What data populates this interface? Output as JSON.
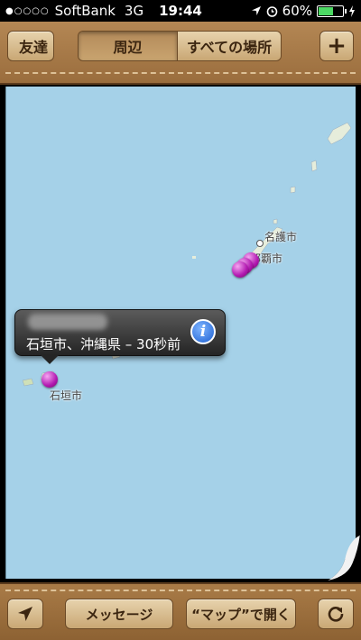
{
  "status_bar": {
    "signal": "●○○○○",
    "carrier": "SoftBank",
    "network": "3G",
    "time": "19:44",
    "battery": "60%",
    "battery_level": 0.6
  },
  "top_bar": {
    "back_label": "友達",
    "segments": [
      "周辺",
      "すべての場所"
    ],
    "selected_segment": "周辺",
    "add_label": "+"
  },
  "map": {
    "labels": {
      "nago": "名護市",
      "naha": "那覇市",
      "ishigaki": "石垣市"
    },
    "callout": {
      "subtitle": "石垣市、沖縄県 – 30秒前",
      "info_icon": "i"
    }
  },
  "bottom_bar": {
    "message_label": "メッセージ",
    "open_maps_label": "“マップ”で開く"
  },
  "colors": {
    "leather": "#a97b47",
    "sea": "#a5d1e8",
    "pin": "#b218b0"
  },
  "icons": [
    "location-arrow-icon",
    "refresh-icon",
    "info-icon",
    "plus-icon"
  ]
}
